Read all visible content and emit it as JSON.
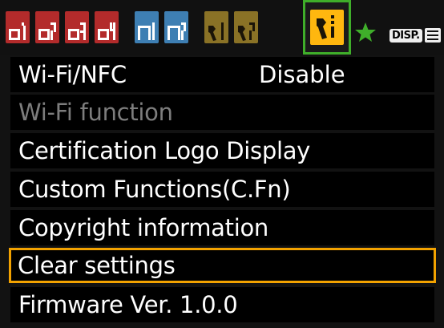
{
  "tabs": [
    {
      "name": "shooting-tab-1",
      "group": "shoot",
      "num": "1",
      "color": "#b32b2b",
      "active": false
    },
    {
      "name": "shooting-tab-2",
      "group": "shoot",
      "num": "2",
      "color": "#b32b2b",
      "active": false
    },
    {
      "name": "shooting-tab-3",
      "group": "shoot",
      "num": "3",
      "color": "#b32b2b",
      "active": false
    },
    {
      "name": "shooting-tab-4",
      "group": "shoot",
      "num": "4",
      "color": "#b32b2b",
      "active": false
    },
    {
      "name": "playback-tab-1",
      "group": "play",
      "num": "1",
      "color": "#3e7fb3",
      "active": false
    },
    {
      "name": "playback-tab-2",
      "group": "play",
      "num": "2",
      "color": "#3e7fb3",
      "active": false
    },
    {
      "name": "setup-tab-1",
      "group": "setup",
      "num": "1",
      "color": "#8a7226",
      "active": false
    },
    {
      "name": "setup-tab-2",
      "group": "setup",
      "num": "2",
      "color": "#8a7226",
      "active": false
    },
    {
      "name": "setup-tab-3",
      "group": "setup",
      "num": "3",
      "color": "#ffb70f",
      "active": true
    },
    {
      "name": "my-menu-tab",
      "group": "star",
      "color": "#3fae2a",
      "active": false
    }
  ],
  "disp_button": {
    "label": "DISP."
  },
  "menu": {
    "items": [
      {
        "label": "Wi-Fi/NFC",
        "value": "Disable",
        "state": "normal"
      },
      {
        "label": "Wi-Fi function",
        "value": "",
        "state": "disabled"
      },
      {
        "label": "Certification Logo Display",
        "value": "",
        "state": "normal"
      },
      {
        "label": "Custom Functions(C.Fn)",
        "value": "",
        "state": "normal"
      },
      {
        "label": "Copyright information",
        "value": "",
        "state": "normal"
      },
      {
        "label": "Clear settings",
        "value": "",
        "state": "selected"
      },
      {
        "label": "Firmware Ver. 1.0.0",
        "value": "",
        "state": "normal"
      }
    ]
  },
  "colors": {
    "selection_border": "#f2a200",
    "active_tab_frame": "#3fae2a",
    "active_tab_fill": "#ffb70f",
    "text": "#ffffff",
    "disabled_text": "#7d7d7d"
  }
}
